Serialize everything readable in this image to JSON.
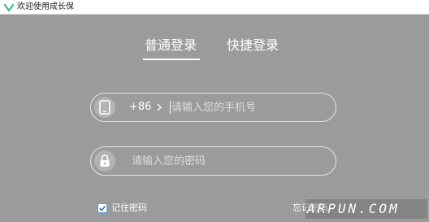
{
  "window": {
    "title": "欢迎使用成长保"
  },
  "tabs": [
    {
      "label": "普通登录",
      "active": true
    },
    {
      "label": "快捷登录",
      "active": false
    }
  ],
  "phone_field": {
    "icon": "phone-icon",
    "country_code": "+86",
    "placeholder": "请输入您的手机号",
    "value": ""
  },
  "password_field": {
    "icon": "lock-icon",
    "placeholder": "请输入您的密码",
    "value": ""
  },
  "remember": {
    "label": "记住密码",
    "checked": true
  },
  "forgot": {
    "label": "忘记密码"
  },
  "watermark": {
    "text": "ARPUN.COM"
  },
  "colors": {
    "background": "#9b9b9b",
    "text": "#ffffff",
    "titlebar": "#ffffff",
    "brand": "#3dbd7d"
  }
}
